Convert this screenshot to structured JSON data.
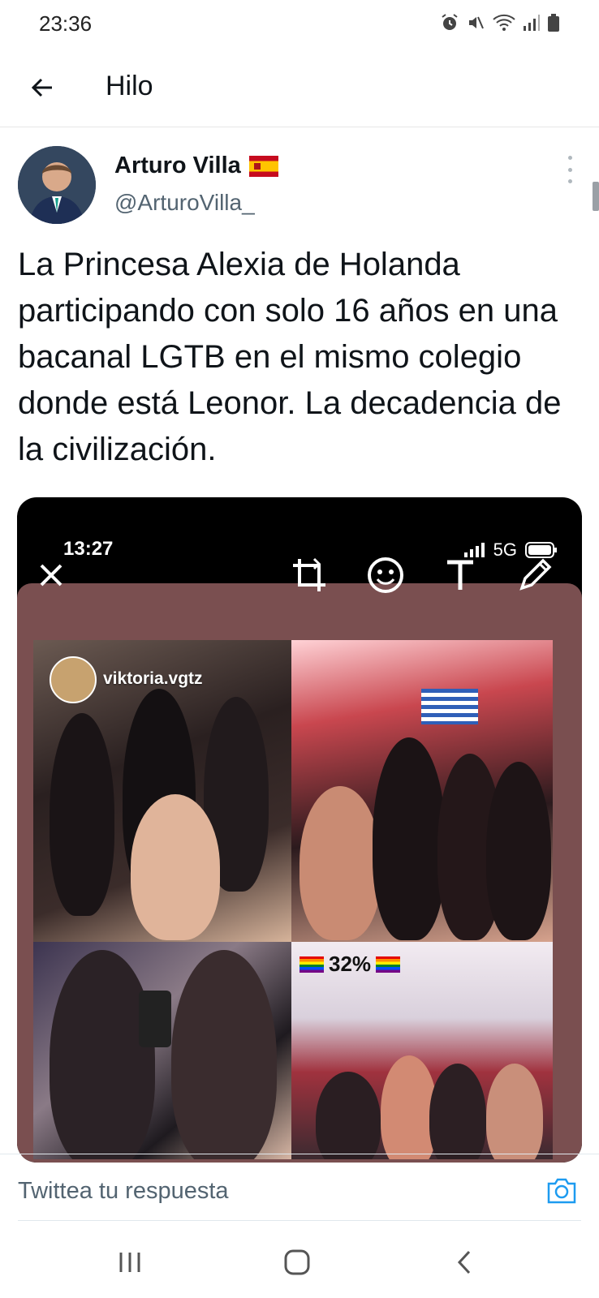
{
  "status_bar": {
    "time": "23:36",
    "icons": [
      "alarm-icon",
      "mute-icon",
      "wifi-icon",
      "signal-icon",
      "battery-icon"
    ]
  },
  "header": {
    "title": "Hilo",
    "back_icon": "arrow-left-icon"
  },
  "tweet": {
    "author_name": "Arturo Villa",
    "author_flag": "spain-flag",
    "author_handle": "@ArturoVilla_",
    "text": "La Princesa Alexia de Holanda participando con solo 16 años en una bacanal LGTB en el mismo colegio donde está Leonor. La decadencia de la civilización.",
    "media": {
      "screenshot_time": "13:27",
      "screenshot_network": "5G",
      "editor_icons": [
        "close-icon",
        "crop-icon",
        "sticker-icon",
        "text-icon",
        "pencil-icon"
      ],
      "overlay_handle": "viktoria.vgtz",
      "overlay_percent": "32%"
    }
  },
  "reply": {
    "placeholder": "Twittea tu respuesta"
  },
  "colors": {
    "text": "#0f1419",
    "secondary": "#536471",
    "accent": "#1d9bf0"
  }
}
